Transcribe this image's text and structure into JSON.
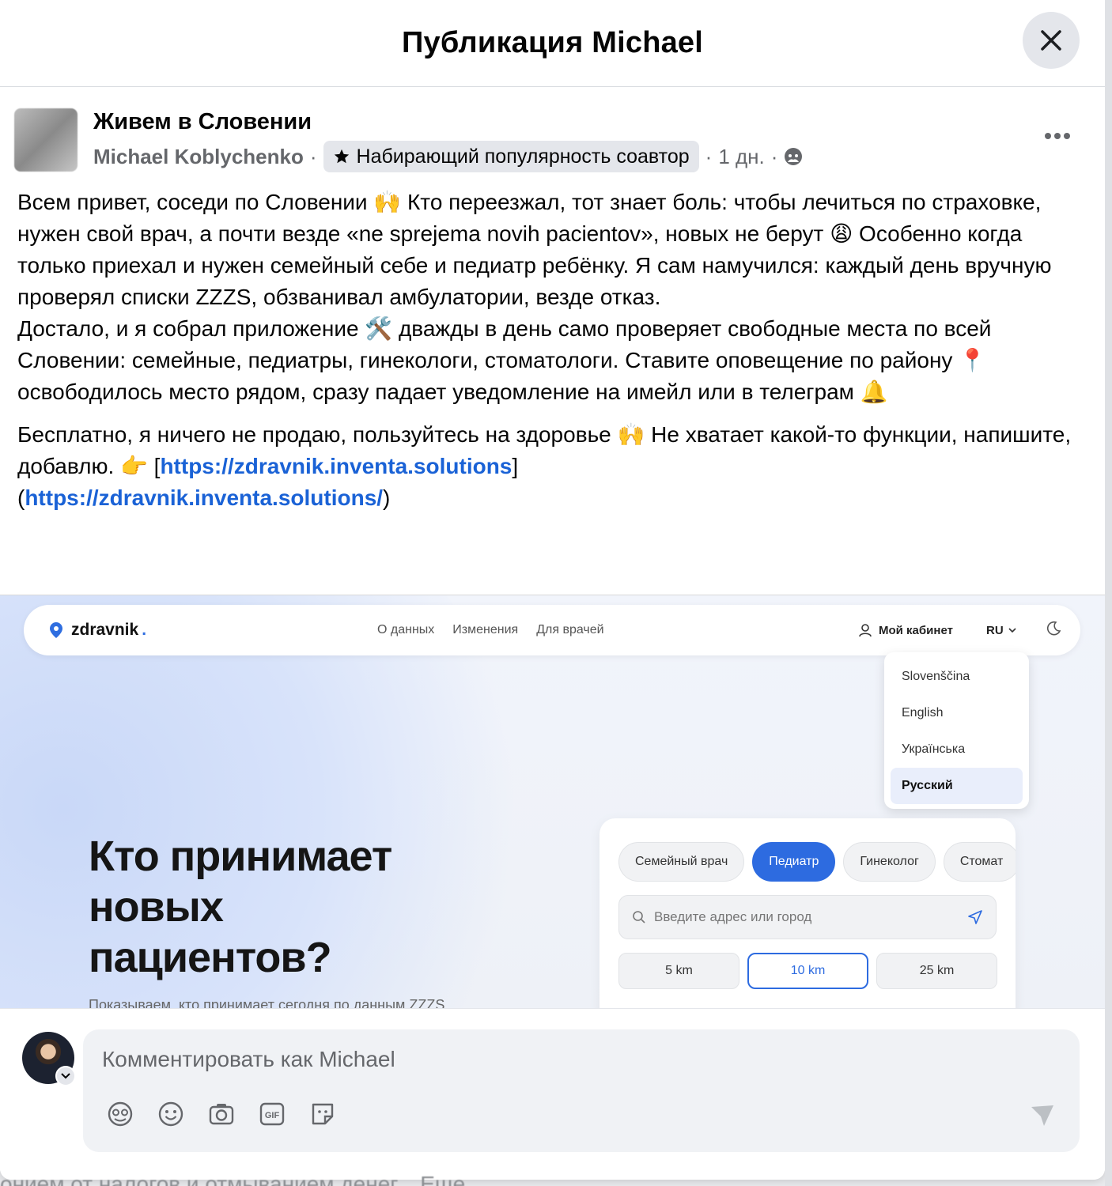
{
  "modal": {
    "title": "Публикация Michael"
  },
  "post": {
    "group_name": "Живем в Словении",
    "author": "Michael Koblychenko",
    "badge": "Набирающий популярность соавтор",
    "time": "1 дн.",
    "paragraphs": [
      "Всем привет, соседи по Словении 🙌 Кто переезжал, тот знает боль: чтобы лечиться по страховке, нужен свой врач, а почти везде «ne sprejema novih pacientov», новых не берут 😩 Особенно когда только приехал и нужен семейный себе и педиатр ребёнку. Я сам намучился: каждый день вручную проверял списки ZZZS, обзванивал амбулатории, везде отказ.",
      "Достало, и я собрал приложение 🛠️ дважды в день само проверяет свободные места по всей Словении: семейные, педиатры, гинекологи, стоматологи. Ставите оповещение по району 📍 освободилось место рядом, сразу падает уведомление на имейл или в телеграм 🔔"
    ],
    "last_paragraph_text": "Бесплатно, я ничего не продаю, пользуйтесь на здоровье 🙌 Не хватает какой-то функции, напишите, добавлю. 👉  [",
    "link1": "https://zdravnik.inventa.solutions",
    "link_mid": "]\n(",
    "link2": "https://zdravnik.inventa.solutions/",
    "link_end": ")"
  },
  "screenshot": {
    "logo": "zdravnik",
    "logo_dot": ".",
    "nav_links": [
      "О данных",
      "Изменения",
      "Для врачей"
    ],
    "cabinet": "Мой кабинет",
    "lang": "RU",
    "languages": [
      "Slovenščina",
      "English",
      "Українська",
      "Русский"
    ],
    "active_language": "Русский",
    "hero_title": "Кто принимает новых пациентов?",
    "hero_sub": "Показываем, кто принимает сегодня по данным ZZZS",
    "chips": [
      "Семейный врач",
      "Педиатр",
      "Гинеколог",
      "Стомат"
    ],
    "active_chip": "Педиатр",
    "address_placeholder": "Введите адрес или город",
    "distances": [
      "5 km",
      "10 km",
      "25 km"
    ],
    "active_distance": "10 km"
  },
  "composer": {
    "placeholder": "Комментировать как Michael",
    "tools": [
      "avatar-sticker-icon",
      "emoji-icon",
      "camera-icon",
      "gif-icon",
      "sticker-icon"
    ]
  },
  "background_text": "онием от налогов и отмыванием денег... Еще",
  "colors": {
    "link": "#1a62d6",
    "accent": "#2d6be0",
    "badge_bg": "#e4e6eb"
  }
}
